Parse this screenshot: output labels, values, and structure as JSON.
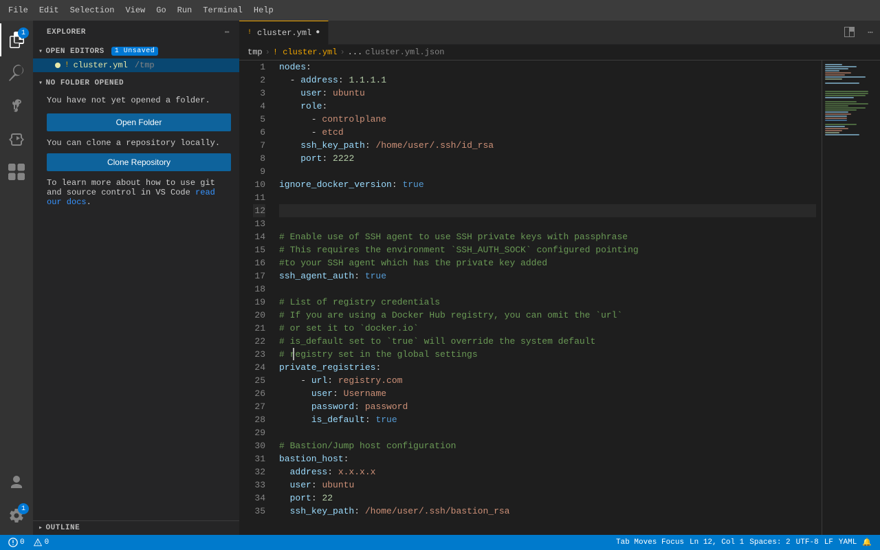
{
  "menu": {
    "items": [
      "File",
      "Edit",
      "Selection",
      "View",
      "Go",
      "Run",
      "Terminal",
      "Help"
    ]
  },
  "activity_bar": {
    "icons": [
      {
        "name": "explorer",
        "label": "Explorer",
        "active": true,
        "badge": "1"
      },
      {
        "name": "search",
        "label": "Search"
      },
      {
        "name": "source-control",
        "label": "Source Control"
      },
      {
        "name": "run-debug",
        "label": "Run and Debug"
      },
      {
        "name": "extensions",
        "label": "Extensions"
      }
    ],
    "bottom_icons": [
      {
        "name": "account",
        "label": "Account"
      },
      {
        "name": "settings",
        "label": "Manage",
        "badge": "1"
      }
    ]
  },
  "sidebar": {
    "title": "Explorer",
    "open_editors": {
      "label": "Open Editors",
      "badge": "1 Unsaved",
      "files": [
        {
          "dot": true,
          "exclaim": true,
          "name": "cluster.yml",
          "path": "/tmp"
        }
      ]
    },
    "no_folder": {
      "label": "No Folder Opened",
      "text": "You have not yet opened a folder.",
      "open_button": "Open Folder",
      "clone_text": "You can clone a repository locally.",
      "clone_button": "Clone Repository",
      "learn_text": "To learn more about how to use git and source control in VS Code ",
      "learn_link": "read our docs",
      "learn_end": "."
    },
    "outline": {
      "label": "Outline"
    }
  },
  "editor": {
    "tab": {
      "exclaim": "!",
      "filename": "cluster.yml",
      "modified": true
    },
    "breadcrumb": {
      "root": "tmp",
      "sep1": ">",
      "file": "! cluster.yml",
      "sep2": ">",
      "dots": "...",
      "json": "cluster.yml.json"
    },
    "lines": [
      {
        "n": 1,
        "content": "nodes:"
      },
      {
        "n": 2,
        "content": "  - address: 1.1.1.1"
      },
      {
        "n": 3,
        "content": "    user: ubuntu"
      },
      {
        "n": 4,
        "content": "    role:"
      },
      {
        "n": 5,
        "content": "      - controlplane"
      },
      {
        "n": 6,
        "content": "      - etcd"
      },
      {
        "n": 7,
        "content": "    ssh_key_path: /home/user/.ssh/id_rsa"
      },
      {
        "n": 8,
        "content": "    port: 2222"
      },
      {
        "n": 9,
        "content": ""
      },
      {
        "n": 10,
        "content": "ignore_docker_version: true"
      },
      {
        "n": 11,
        "content": ""
      },
      {
        "n": 12,
        "content": ""
      },
      {
        "n": 13,
        "content": ""
      },
      {
        "n": 14,
        "content": "# Enable use of SSH agent to use SSH private keys with passphrase"
      },
      {
        "n": 15,
        "content": "# This requires the environment `SSH_AUTH_SOCK` configured pointing"
      },
      {
        "n": 16,
        "content": "#to your SSH agent which has the private key added"
      },
      {
        "n": 17,
        "content": "ssh_agent_auth: true"
      },
      {
        "n": 18,
        "content": ""
      },
      {
        "n": 19,
        "content": "# List of registry credentials"
      },
      {
        "n": 20,
        "content": "# If you are using a Docker Hub registry, you can omit the `url`"
      },
      {
        "n": 21,
        "content": "# or set it to `docker.io`"
      },
      {
        "n": 22,
        "content": "# is_default set to `true` will override the system default"
      },
      {
        "n": 23,
        "content": "# registry set in the global settings"
      },
      {
        "n": 24,
        "content": "private_registries:"
      },
      {
        "n": 25,
        "content": "    - url: registry.com"
      },
      {
        "n": 26,
        "content": "      user: Username"
      },
      {
        "n": 27,
        "content": "      password: password"
      },
      {
        "n": 28,
        "content": "      is_default: true"
      },
      {
        "n": 29,
        "content": ""
      },
      {
        "n": 30,
        "content": "# Bastion/Jump host configuration"
      },
      {
        "n": 31,
        "content": "bastion_host:"
      },
      {
        "n": 32,
        "content": "  address: x.x.x.x"
      },
      {
        "n": 33,
        "content": "  user: ubuntu"
      },
      {
        "n": 34,
        "content": "  port: 22"
      },
      {
        "n": 35,
        "content": "  ssh_key_path: /home/user/.ssh/bastion_rsa"
      }
    ],
    "cursor": {
      "line": 12,
      "col": 1
    }
  },
  "status_bar": {
    "errors": "0",
    "warnings": "0",
    "position": "Ln 12, Col 1",
    "spaces": "Spaces: 2",
    "encoding": "UTF-8",
    "line_ending": "LF",
    "language": "YAML",
    "tab_focus": "Tab Moves Focus",
    "bell": "🔔",
    "col_label": "Col"
  }
}
